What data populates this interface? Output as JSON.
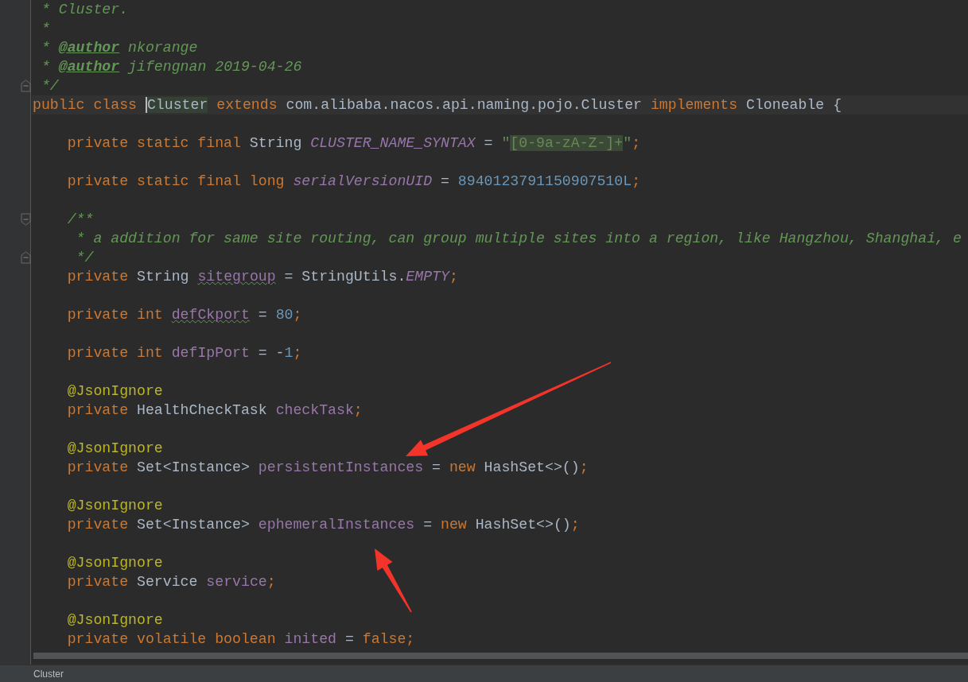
{
  "editor": {
    "lines": [
      {
        "tokens": [
          {
            "text": " * Cluster.",
            "kind": "doc"
          }
        ]
      },
      {
        "tokens": [
          {
            "text": " *",
            "kind": "doc"
          }
        ]
      },
      {
        "tokens": [
          {
            "text": " * ",
            "kind": "doc"
          },
          {
            "text": "@author",
            "kind": "doctag"
          },
          {
            "text": " nkorange",
            "kind": "doc"
          }
        ]
      },
      {
        "tokens": [
          {
            "text": " * ",
            "kind": "doc"
          },
          {
            "text": "@author",
            "kind": "doctag"
          },
          {
            "text": " jifengnan 2019-04-26",
            "kind": "doc"
          }
        ]
      },
      {
        "fold_end": true,
        "tokens": [
          {
            "text": " */",
            "kind": "doc"
          }
        ]
      },
      {
        "current": true,
        "tokens": [
          {
            "text": "public class ",
            "kind": "kw"
          },
          {
            "text": "Cluster",
            "kind": "plain",
            "highlight": true
          },
          {
            "text": " extends ",
            "kind": "kw"
          },
          {
            "text": "com.alibaba.nacos.api.naming.pojo.Cluster",
            "kind": "plain"
          },
          {
            "text": " implements ",
            "kind": "kw"
          },
          {
            "text": "Cloneable {",
            "kind": "plain"
          }
        ]
      },
      {
        "blank_before": true,
        "tokens": [
          {
            "text": "    private static final ",
            "kind": "kw"
          },
          {
            "text": "String ",
            "kind": "plain"
          },
          {
            "text": "CLUSTER_NAME_SYNTAX",
            "kind": "static"
          },
          {
            "text": " = ",
            "kind": "plain"
          },
          {
            "text": "\"",
            "kind": "str"
          },
          {
            "text": "[0-9a-zA-Z-]+",
            "kind": "regex"
          },
          {
            "text": "\"",
            "kind": "str"
          },
          {
            "text": ";",
            "kind": "kw"
          }
        ]
      },
      {
        "blank_before": true,
        "tokens": [
          {
            "text": "    private static final long ",
            "kind": "kw"
          },
          {
            "text": "serialVersionUID",
            "kind": "static"
          },
          {
            "text": " = ",
            "kind": "plain"
          },
          {
            "text": "8940123791150907510L",
            "kind": "num"
          },
          {
            "text": ";",
            "kind": "kw"
          }
        ]
      },
      {
        "blank_before": true,
        "fold_start": true,
        "tokens": [
          {
            "text": "    /**",
            "kind": "doc"
          }
        ]
      },
      {
        "tokens": [
          {
            "text": "     * a addition for same site routing, can group multiple sites into a region, like Hangzhou, Shanghai, e",
            "kind": "doc"
          }
        ]
      },
      {
        "fold_end": true,
        "tokens": [
          {
            "text": "     */",
            "kind": "doc"
          }
        ]
      },
      {
        "tokens": [
          {
            "text": "    private ",
            "kind": "kw"
          },
          {
            "text": "String ",
            "kind": "plain"
          },
          {
            "text": "sitegroup",
            "kind": "field",
            "typo": true
          },
          {
            "text": " = StringUtils.",
            "kind": "plain"
          },
          {
            "text": "EMPTY",
            "kind": "static"
          },
          {
            "text": ";",
            "kind": "kw"
          }
        ]
      },
      {
        "blank_before": true,
        "tokens": [
          {
            "text": "    private int ",
            "kind": "kw"
          },
          {
            "text": "defCkport",
            "kind": "field",
            "typo": true
          },
          {
            "text": " = ",
            "kind": "plain"
          },
          {
            "text": "80",
            "kind": "num"
          },
          {
            "text": ";",
            "kind": "kw"
          }
        ]
      },
      {
        "blank_before": true,
        "tokens": [
          {
            "text": "    private int ",
            "kind": "kw"
          },
          {
            "text": "defIpPort",
            "kind": "field"
          },
          {
            "text": " = -",
            "kind": "plain"
          },
          {
            "text": "1",
            "kind": "num"
          },
          {
            "text": ";",
            "kind": "kw"
          }
        ]
      },
      {
        "blank_before": true,
        "tokens": [
          {
            "text": "    @JsonIgnore",
            "kind": "ann"
          }
        ]
      },
      {
        "tokens": [
          {
            "text": "    private ",
            "kind": "kw"
          },
          {
            "text": "HealthCheckTask ",
            "kind": "plain"
          },
          {
            "text": "checkTask",
            "kind": "field"
          },
          {
            "text": ";",
            "kind": "kw"
          }
        ]
      },
      {
        "blank_before": true,
        "tokens": [
          {
            "text": "    @JsonIgnore",
            "kind": "ann"
          }
        ]
      },
      {
        "tokens": [
          {
            "text": "    private ",
            "kind": "kw"
          },
          {
            "text": "Set<Instance> ",
            "kind": "plain"
          },
          {
            "text": "persistentInstances",
            "kind": "field"
          },
          {
            "text": " = ",
            "kind": "plain"
          },
          {
            "text": "new ",
            "kind": "kw"
          },
          {
            "text": "HashSet<>()",
            "kind": "plain"
          },
          {
            "text": ";",
            "kind": "kw"
          }
        ]
      },
      {
        "blank_before": true,
        "tokens": [
          {
            "text": "    @JsonIgnore",
            "kind": "ann"
          }
        ]
      },
      {
        "tokens": [
          {
            "text": "    private ",
            "kind": "kw"
          },
          {
            "text": "Set<Instance> ",
            "kind": "plain"
          },
          {
            "text": "ephemeralInstances",
            "kind": "field"
          },
          {
            "text": " = ",
            "kind": "plain"
          },
          {
            "text": "new ",
            "kind": "kw"
          },
          {
            "text": "HashSet<>()",
            "kind": "plain"
          },
          {
            "text": ";",
            "kind": "kw"
          }
        ]
      },
      {
        "blank_before": true,
        "tokens": [
          {
            "text": "    @JsonIgnore",
            "kind": "ann"
          }
        ]
      },
      {
        "tokens": [
          {
            "text": "    private ",
            "kind": "kw"
          },
          {
            "text": "Service ",
            "kind": "plain"
          },
          {
            "text": "service",
            "kind": "field"
          },
          {
            "text": ";",
            "kind": "kw"
          }
        ]
      },
      {
        "blank_before": true,
        "tokens": [
          {
            "text": "    @JsonIgnore",
            "kind": "ann"
          }
        ]
      },
      {
        "tokens": [
          {
            "text": "    private volatile boolean ",
            "kind": "kw"
          },
          {
            "text": "inited",
            "kind": "field"
          },
          {
            "text": " = ",
            "kind": "plain"
          },
          {
            "text": "false",
            "kind": "kw"
          },
          {
            "text": ";",
            "kind": "kw"
          }
        ]
      }
    ]
  },
  "status_bar": {
    "breadcrumb": "Cluster"
  }
}
